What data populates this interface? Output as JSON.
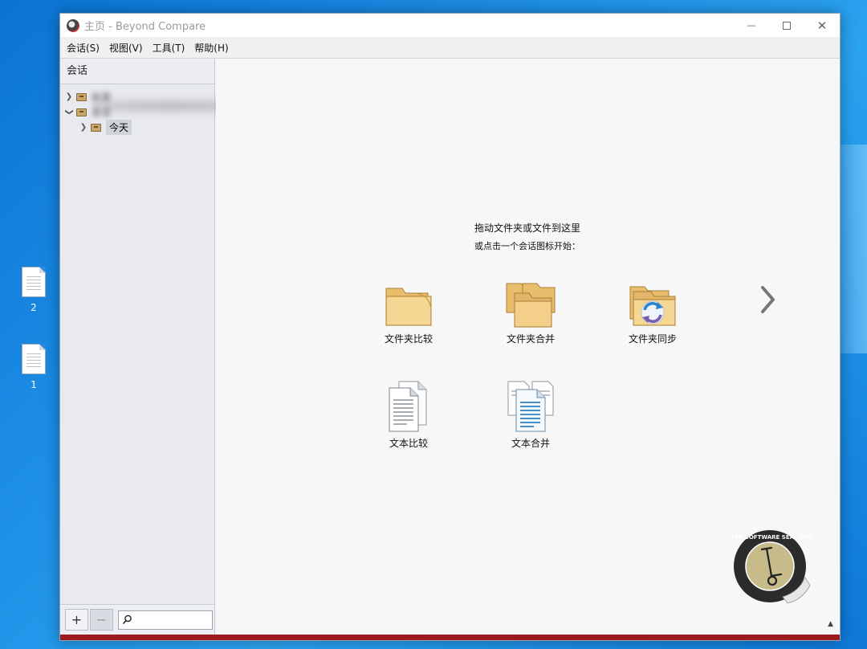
{
  "desktop": {
    "icons": [
      {
        "label": "2"
      },
      {
        "label": "1"
      }
    ]
  },
  "window": {
    "title": "主页 - Beyond Compare",
    "controls": {
      "minimize": "—",
      "close": "✕"
    }
  },
  "menu": [
    "会话(S)",
    "视图(V)",
    "工具(T)",
    "帮助(H)"
  ],
  "sidebar": {
    "header": "会话",
    "tree": [
      {
        "label": "新建",
        "expanded": false,
        "blurred": true
      },
      {
        "label": "会话",
        "expanded": true,
        "blurred": true
      },
      {
        "label": "今天",
        "expanded": false,
        "blurred": false,
        "selected": true
      }
    ],
    "add_label": "+",
    "remove_label": "−",
    "search_value": ""
  },
  "main": {
    "hint_line1": "拖动文件夹或文件到这里",
    "hint_line2": "或点击一个会话图标开始：",
    "tiles": [
      {
        "label": "文件夹比较",
        "icon": "folder-compare-icon"
      },
      {
        "label": "文件夹合并",
        "icon": "folder-merge-icon"
      },
      {
        "label": "文件夹同步",
        "icon": "folder-sync-icon"
      },
      {
        "label": "文本比较",
        "icon": "text-compare-icon"
      },
      {
        "label": "文本合并",
        "icon": "text-merge-icon"
      }
    ],
    "seal_text": "SCOOTER SOFTWARE SEAL QUALITY"
  },
  "colors": {
    "desktop": "#1e8fe6",
    "folder": "#f4d28e",
    "sync_blue": "#2a82c8",
    "footer_bar": "#9b1b1f"
  }
}
